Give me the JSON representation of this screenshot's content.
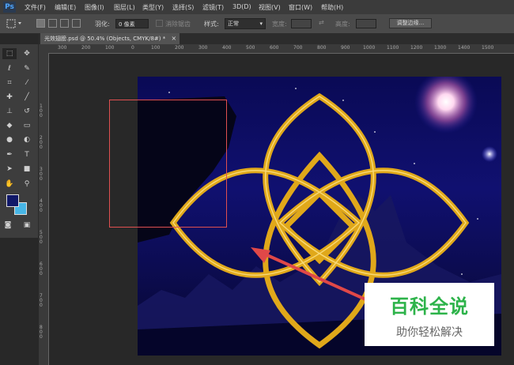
{
  "app": {
    "logo": "Ps"
  },
  "menu": [
    "文件(F)",
    "编辑(E)",
    "图像(I)",
    "图层(L)",
    "类型(Y)",
    "选择(S)",
    "滤镜(T)",
    "3D(D)",
    "视图(V)",
    "窗口(W)",
    "帮助(H)"
  ],
  "options": {
    "feather_label": "羽化:",
    "feather_value": "0 像素",
    "antialias_label": "消除锯齿",
    "style_label": "样式:",
    "style_value": "正常",
    "width_label": "宽度:",
    "height_label": "高度:",
    "refine_edge": "调整边缘..."
  },
  "document_tab": {
    "title": "光效翅膀.psd @ 50.4% (Objects, CMYK/8#) *",
    "close": "×"
  },
  "ruler_h": [
    "300",
    "200",
    "100",
    "0",
    "100",
    "200",
    "300",
    "400",
    "500",
    "600",
    "700",
    "800",
    "900",
    "1000",
    "1100",
    "1200",
    "1300",
    "1400",
    "1500"
  ],
  "ruler_v": [
    "1 0 0",
    "2 0 0",
    "3 0 0",
    "4 0 0",
    "5 0 0",
    "6 0 0",
    "7 0 0",
    "8 0 0"
  ],
  "watermark": {
    "title": "百科全说",
    "subtitle": "助你轻松解决"
  },
  "colors": {
    "foreground": "#101868",
    "background": "#47b6e6",
    "selection": "#e05050",
    "arrow": "#e04848",
    "knot": "#e0a81a"
  },
  "tools": [
    "marquee-icon",
    "move-icon",
    "lasso-icon",
    "quick-select-icon",
    "crop-icon",
    "eyedropper-icon",
    "healing-icon",
    "brush-icon",
    "clone-stamp-icon",
    "history-brush-icon",
    "eraser-icon",
    "gradient-icon",
    "blur-icon",
    "dodge-icon",
    "pen-icon",
    "type-icon",
    "path-select-icon",
    "rectangle-icon",
    "hand-icon",
    "zoom-icon"
  ]
}
